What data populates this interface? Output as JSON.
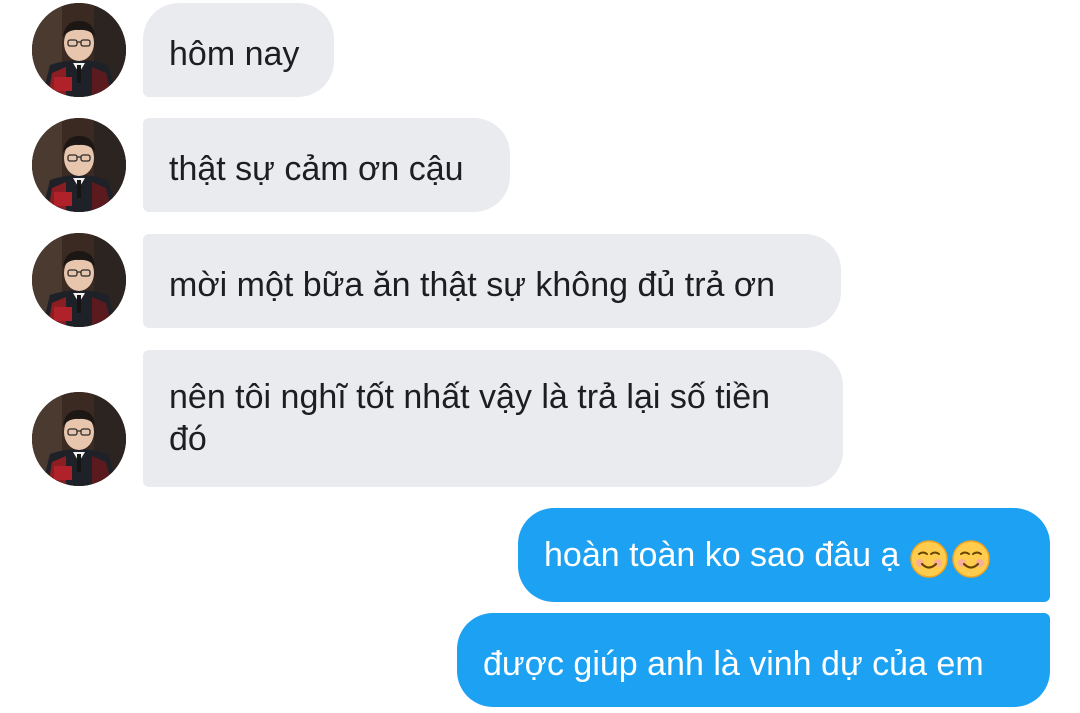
{
  "conversation": {
    "messages": [
      {
        "sender": "other",
        "text": "hôm nay"
      },
      {
        "sender": "other",
        "text": "thật sự cảm ơn cậu"
      },
      {
        "sender": "other",
        "text": "mời một bữa ăn thật sự không đủ trả ơn"
      },
      {
        "sender": "other",
        "text": "nên tôi nghĩ tốt nhất vậy là trả lại số tiền đó"
      },
      {
        "sender": "me",
        "text": "hoàn toàn ko sao đâu ạ ☺☺",
        "text_label": "hoàn toàn ko sao đâu ạ"
      },
      {
        "sender": "me",
        "text": "được giúp anh là vinh dự của em"
      }
    ]
  },
  "icons": {
    "avatar": "contact-avatar-photo",
    "emoji": "smiling-face-emoji"
  },
  "colors": {
    "incoming_bubble": "#e9ebef",
    "outgoing_bubble": "#1da1f2",
    "incoming_text": "#1c1e21",
    "outgoing_text": "#ffffff"
  }
}
